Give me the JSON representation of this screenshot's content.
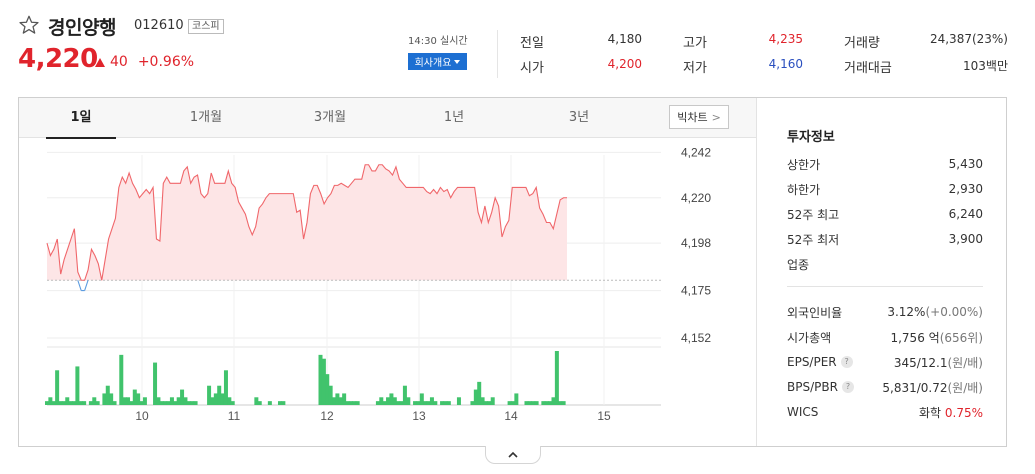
{
  "stock": {
    "name": "경인양행",
    "code": "012610",
    "market": "코스피",
    "price": "4,220",
    "change": "40",
    "change_pct": "+0.96%",
    "realtime": "14:30 실시간",
    "company_info_label": "회사개요"
  },
  "quote": {
    "prev_close_label": "전일",
    "prev_close": "4,180",
    "open_label": "시가",
    "open": "4,200",
    "high_label": "고가",
    "high": "4,235",
    "low_label": "저가",
    "low": "4,160",
    "volume_label": "거래량",
    "volume": "24,387(23%)",
    "amount_label": "거래대금",
    "amount": "103백만"
  },
  "tabs": [
    "1일",
    "1개월",
    "3개월",
    "1년",
    "3년"
  ],
  "bigchart_label": "빅차트",
  "invest": {
    "title": "투자정보",
    "upper_limit_label": "상한가",
    "upper_limit": "5,430",
    "lower_limit_label": "하한가",
    "lower_limit": "2,930",
    "high52_label": "52주 최고",
    "high52": "6,240",
    "low52_label": "52주 최저",
    "low52": "3,900",
    "industry_label": "업종",
    "foreign_label": "외국인비율",
    "foreign": "3.12%",
    "foreign_sub": "(+0.00%)",
    "mcap_label": "시가총액",
    "mcap": "1,756 억",
    "mcap_sub": "(656위)",
    "eps_label": "EPS/PER",
    "eps": "345/12.1",
    "eps_sub": "(원/배)",
    "bps_label": "BPS/PBR",
    "bps": "5,831/0.72",
    "bps_sub": "(원/배)",
    "wics_label": "WICS",
    "wics": "화학",
    "wics_pct": "0.75%",
    "help": "?"
  },
  "colors": {
    "up": "#e0242c",
    "down": "#2a4fbf",
    "volume": "#41c36c",
    "line_up": "#f0676b",
    "fill_up": "#fde5e6",
    "line_down": "#5b9be0"
  },
  "chart_data": {
    "type": "line",
    "title": "",
    "x_ticks": [
      "10",
      "11",
      "12",
      "13",
      "14",
      "15"
    ],
    "y_ticks": [
      4242,
      4220,
      4198,
      4175,
      4152
    ],
    "ylim": [
      4152,
      4248
    ],
    "baseline": 4180,
    "price_series": [
      4198,
      4192,
      4195,
      4200,
      4183,
      4190,
      4195,
      4200,
      4205,
      4184,
      4175,
      4175,
      4185,
      4195,
      4192,
      4188,
      4180,
      4190,
      4200,
      4205,
      4210,
      4225,
      4230,
      4227,
      4232,
      4227,
      4224,
      4220,
      4222,
      4224,
      4222,
      4225,
      4200,
      4199,
      4227,
      4230,
      4227,
      4227,
      4227,
      4227,
      4233,
      4235,
      4227,
      4230,
      4231,
      4222,
      4220,
      4222,
      4232,
      4227,
      4227,
      4227,
      4227,
      4233,
      4227,
      4225,
      4218,
      4215,
      4212,
      4206,
      4202,
      4206,
      4215,
      4217,
      4220,
      4222,
      4222,
      4222,
      4222,
      4222,
      4222,
      4222,
      4222,
      4213,
      4214,
      4200,
      4208,
      4222,
      4226,
      4226,
      4222,
      4217,
      4220,
      4222,
      4226,
      4226,
      4227,
      4226,
      4225,
      4227,
      4229,
      4229,
      4229,
      4236,
      4236,
      4233,
      4233,
      4236,
      4236,
      4234,
      4233,
      4231,
      4235,
      4229,
      4227,
      4225,
      4225,
      4225,
      4225,
      4225,
      4225,
      4223,
      4222,
      4224,
      4222,
      4225,
      4223,
      4224,
      4220,
      4223,
      4225,
      4225,
      4225,
      4225,
      4225,
      4225,
      4213,
      4208,
      4216,
      4208,
      4213,
      4220,
      4216,
      4201,
      4206,
      4209,
      4225,
      4225,
      4225,
      4225,
      4225,
      4221,
      4222,
      4225,
      4215,
      4212,
      4208,
      4208,
      4205,
      4212,
      4219,
      4220,
      4220
    ],
    "volume_series": [
      1,
      2,
      1,
      9,
      1,
      1,
      2,
      1,
      1,
      10,
      1,
      1,
      0,
      1,
      2,
      1,
      0,
      3,
      5,
      3,
      1,
      0,
      13,
      2,
      2,
      1,
      4,
      3,
      1,
      2,
      0,
      0,
      11,
      2,
      1,
      1,
      1,
      2,
      1,
      2,
      4,
      2,
      1,
      1,
      1,
      0,
      0,
      0,
      5,
      2,
      3,
      5,
      3,
      9,
      2,
      1,
      0,
      0,
      0,
      0,
      0,
      0,
      2,
      1,
      0,
      0,
      1,
      0,
      0,
      1,
      1,
      0,
      0,
      0,
      0,
      0,
      0,
      0,
      0,
      0,
      0,
      13,
      12,
      8,
      5,
      2,
      3,
      2,
      3,
      1,
      1,
      1,
      1,
      0,
      0,
      0,
      0,
      0,
      1,
      2,
      1,
      2,
      3,
      2,
      1,
      1,
      5,
      2,
      0,
      1,
      1,
      3,
      1,
      1,
      2,
      1,
      0,
      1,
      1,
      1,
      0,
      0,
      2,
      0,
      0,
      0,
      1,
      4,
      6,
      2,
      1,
      1,
      2,
      0,
      0,
      0,
      0,
      1,
      1,
      3,
      0,
      0,
      1,
      1,
      1,
      1,
      0,
      1,
      1,
      1,
      2,
      14,
      1,
      1,
      0
    ]
  }
}
